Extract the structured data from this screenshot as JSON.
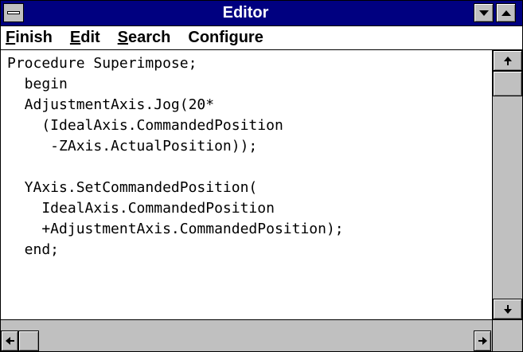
{
  "window": {
    "title": "Editor"
  },
  "menu": {
    "items": [
      {
        "accel": "F",
        "rest": "inish"
      },
      {
        "accel": "E",
        "rest": "dit"
      },
      {
        "accel": "S",
        "rest": "earch"
      },
      {
        "accel": "",
        "rest": "Configure"
      }
    ]
  },
  "editor": {
    "text": "Procedure Superimpose;\n  begin\n  AdjustmentAxis.Jog(20*\n    (IdealAxis.CommandedPosition\n     -ZAxis.ActualPosition));\n\n  YAxis.SetCommandedPosition(\n    IdealAxis.CommandedPosition\n    +AdjustmentAxis.CommandedPosition);\n  end;"
  },
  "icons": {
    "system_menu": "system-menu-icon",
    "minimize": "minimize-icon",
    "maximize": "maximize-icon",
    "scroll_up": "arrow-up-icon",
    "scroll_down": "arrow-down-icon",
    "scroll_left": "arrow-left-icon",
    "scroll_right": "arrow-right-icon"
  },
  "colors": {
    "title_bar": "#000080",
    "title_text": "#ffffff",
    "chrome": "#c0c0c0",
    "text_area": "#ffffff"
  }
}
